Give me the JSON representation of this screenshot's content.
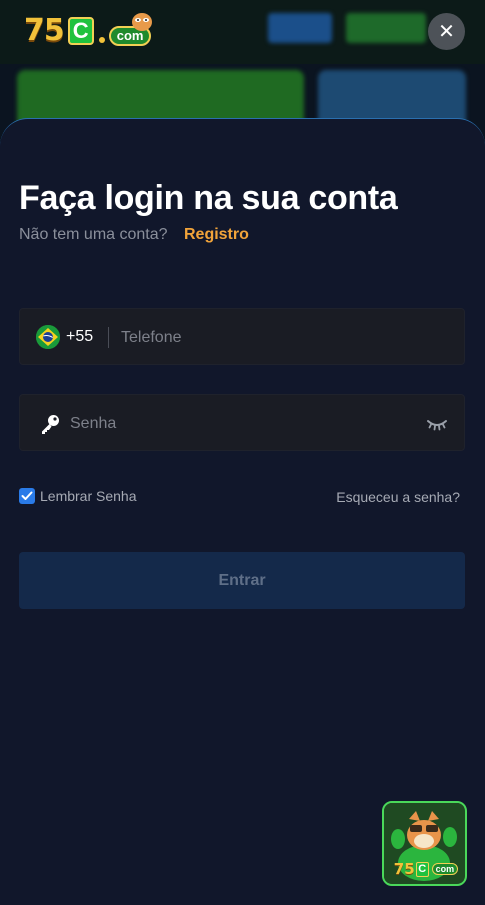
{
  "header": {
    "logo_number": "75",
    "logo_letter": "C",
    "logo_domain": "com",
    "close_label": "✕"
  },
  "modal": {
    "title": "Faça login na sua conta",
    "subtitle": "Não tem uma conta?",
    "register_link": "Registro",
    "phone": {
      "country_flag": "brazil-flag-icon",
      "country_code": "+55",
      "placeholder": "Telefone",
      "value": ""
    },
    "password": {
      "icon": "key-icon",
      "placeholder": "Senha",
      "value": "",
      "toggle_icon": "eye-closed-icon"
    },
    "remember": {
      "label": "Lembrar Senha",
      "checked": true
    },
    "forgot_link": "Esqueceu a senha?",
    "submit_label": "Entrar"
  },
  "app_badge": {
    "number": "75",
    "letter": "C",
    "domain": "com"
  },
  "colors": {
    "modal_bg": "#11172b",
    "accent_orange": "#f2a43a",
    "checkbox_blue": "#2a7be8",
    "submit_bg": "#14294a"
  }
}
